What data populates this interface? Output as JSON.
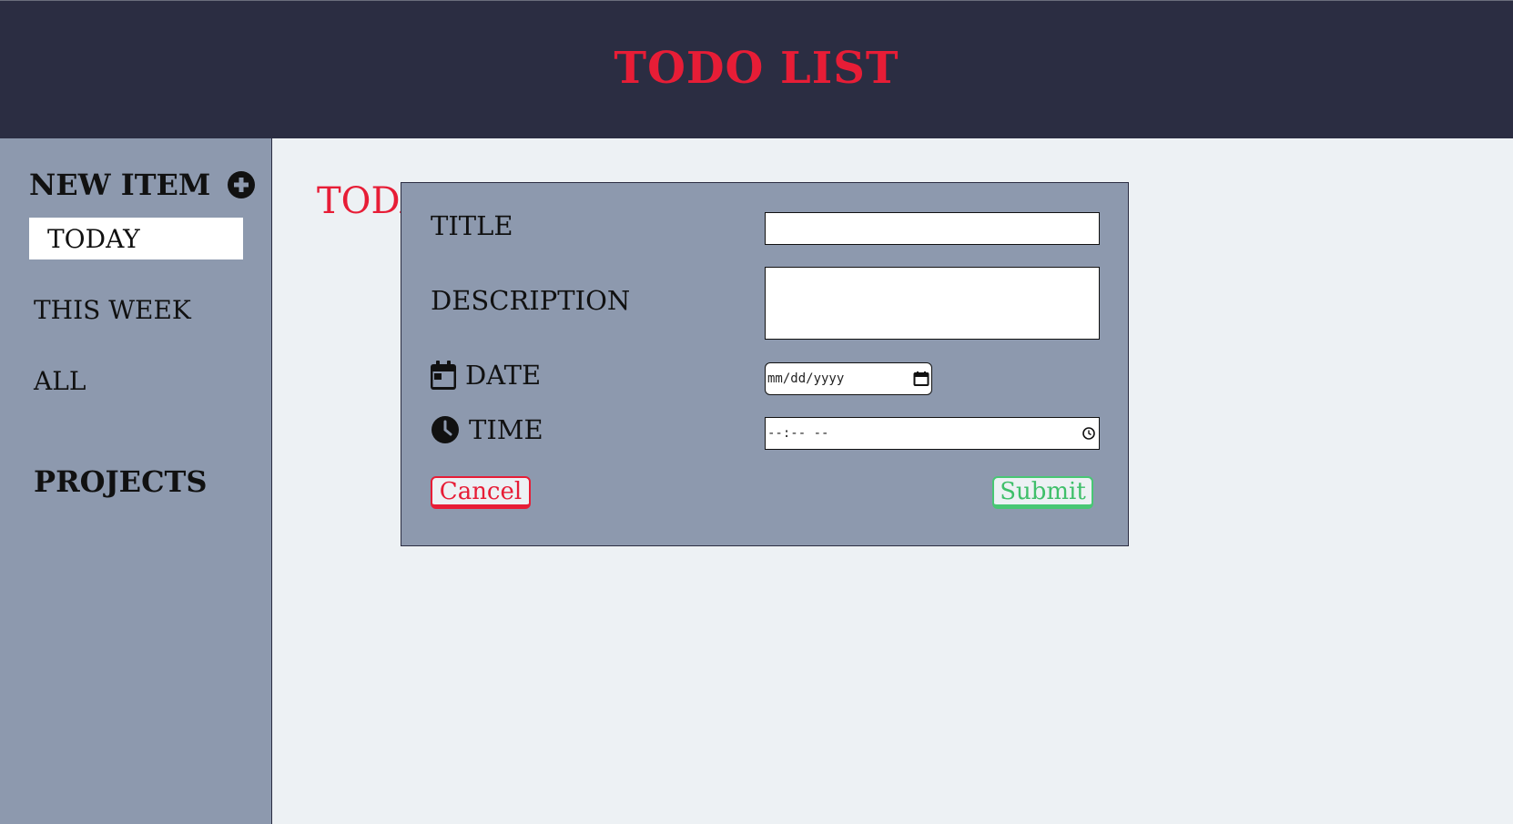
{
  "header": {
    "title": "TODO LIST"
  },
  "sidebar": {
    "new_item_label": "NEW ITEM",
    "items": [
      {
        "label": "TODAY",
        "active": true
      },
      {
        "label": "THIS WEEK",
        "active": false
      },
      {
        "label": "ALL",
        "active": false
      }
    ],
    "projects_label": "PROJECTS"
  },
  "main": {
    "title": "TODAY"
  },
  "modal": {
    "title_label": "TITLE",
    "title_value": "",
    "description_label": "DESCRIPTION",
    "description_value": "",
    "date_label": "DATE",
    "date_placeholder": "mm/dd/yyyy",
    "time_label": "TIME",
    "time_placeholder": "--:-- --",
    "cancel_label": "Cancel",
    "submit_label": "Submit"
  },
  "icons": {
    "new_item": "plus-circle-icon",
    "date": "calendar-icon",
    "time": "clock-icon"
  },
  "colors": {
    "header_bg": "#2b2d42",
    "accent_red": "#e71d36",
    "sidebar_bg": "#8d99ae",
    "main_bg": "#edf1f4",
    "submit_green": "#48c774"
  }
}
